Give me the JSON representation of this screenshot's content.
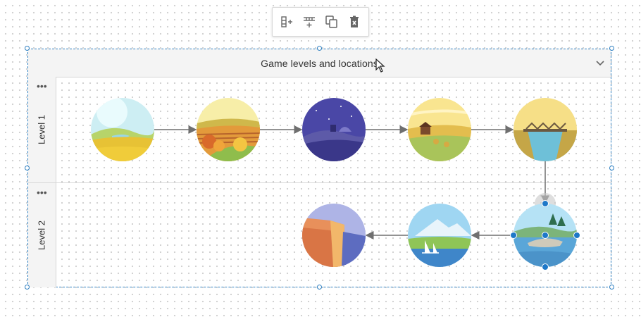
{
  "toolbar": {
    "buttons": [
      {
        "name": "add-lane-icon"
      },
      {
        "name": "add-level-icon"
      },
      {
        "name": "copy-icon"
      },
      {
        "name": "delete-icon"
      }
    ]
  },
  "pool": {
    "title": "Game levels and locations",
    "collapse_icon": "chevron-down-icon"
  },
  "lanes": [
    {
      "label": "Level 1",
      "menu": "•••"
    },
    {
      "label": "Level 2",
      "menu": "•••"
    }
  ],
  "nodes": [
    {
      "name": "meadow-node",
      "lane": "Level 1"
    },
    {
      "name": "autumn-fields-node",
      "lane": "Level 1"
    },
    {
      "name": "night-village-node",
      "lane": "Level 1"
    },
    {
      "name": "farm-node",
      "lane": "Level 1"
    },
    {
      "name": "bridge-node",
      "lane": "Level 1"
    },
    {
      "name": "lake-island-node",
      "lane": "Level 2",
      "selected": true
    },
    {
      "name": "mountain-lake-node",
      "lane": "Level 2"
    },
    {
      "name": "canyon-node",
      "lane": "Level 2"
    }
  ],
  "colors": {
    "selection": "#2d7fc1",
    "connector": "#6f6f6f",
    "header_bg": "#f4f4f4"
  }
}
